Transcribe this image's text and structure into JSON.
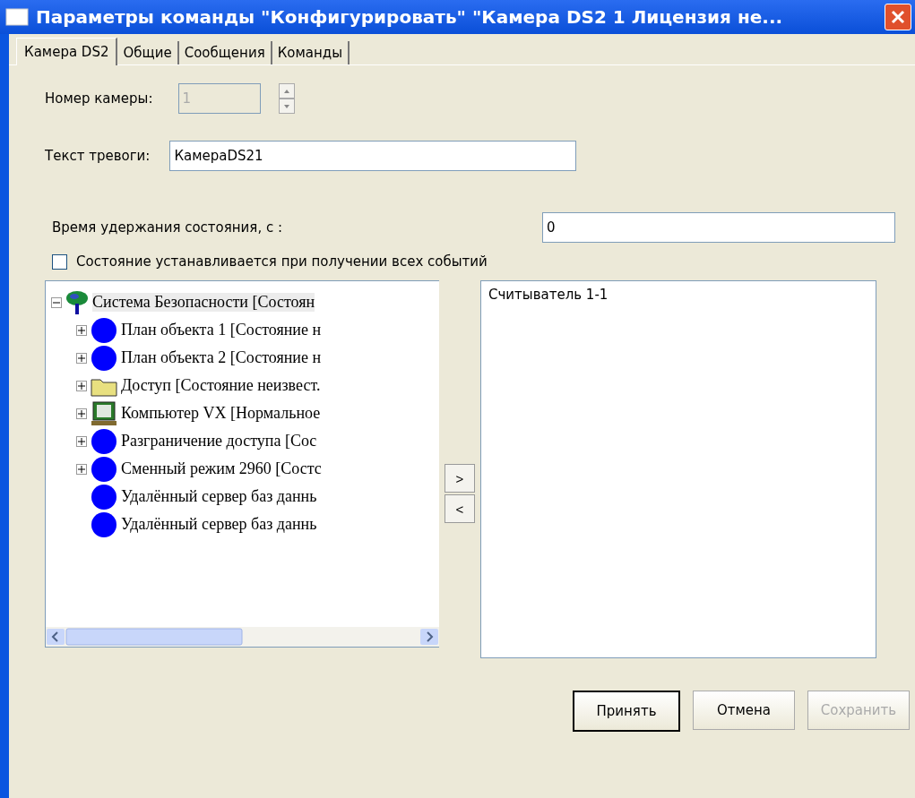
{
  "window": {
    "title": "Параметры команды \"Конфигурировать\" \"Камера DS2 1 Лицензия не..."
  },
  "tabs": [
    {
      "label": "Камера DS2",
      "selected": true
    },
    {
      "label": "Общие",
      "selected": false
    },
    {
      "label": "Сообщения",
      "selected": false
    },
    {
      "label": "Команды",
      "selected": false
    }
  ],
  "camera_number": {
    "label": "Номер камеры:",
    "value": "1",
    "disabled": true
  },
  "alarm_text": {
    "label": "Текст тревоги:",
    "value": "КамераDS21"
  },
  "hold_time": {
    "label": "Время удержания состояния, с :",
    "value": "0"
  },
  "all_events_checkbox": {
    "label": "Состояние устанавливается при получении всех событий",
    "checked": false
  },
  "tree": {
    "label": "Система Безопасности [Состоян",
    "kind": "root",
    "expandable": true,
    "expanded": true,
    "selected": true,
    "children": [
      {
        "label": "План объекта 1 [Состояние н",
        "kind": "dot",
        "expandable": true,
        "expanded": false,
        "selected": false
      },
      {
        "label": "План объекта 2 [Состояние н",
        "kind": "dot",
        "expandable": true,
        "expanded": false,
        "selected": false
      },
      {
        "label": "Доступ [Состояние неизвест.",
        "kind": "folder",
        "expandable": true,
        "expanded": false,
        "selected": false
      },
      {
        "label": "Компьютер VX [Нормальное",
        "kind": "computer",
        "expandable": true,
        "expanded": false,
        "selected": false
      },
      {
        "label": "Разграничение доступа [Сос",
        "kind": "dot",
        "expandable": true,
        "expanded": false,
        "selected": false
      },
      {
        "label": "Сменный режим 2960 [Состс",
        "kind": "dot",
        "expandable": true,
        "expanded": false,
        "selected": false
      },
      {
        "label": "Удалённый сервер баз даннь",
        "kind": "dot",
        "expandable": false,
        "expanded": false,
        "selected": false
      },
      {
        "label": "Удалённый сервер баз даннь",
        "kind": "dot",
        "expandable": false,
        "expanded": false,
        "selected": false
      }
    ]
  },
  "move_buttons": [
    ">",
    "<"
  ],
  "selected_list": [
    {
      "label": "Считыватель 1-1"
    }
  ],
  "buttons": [
    {
      "label": "Принять",
      "default": true,
      "disabled": false
    },
    {
      "label": "Отмена",
      "default": false,
      "disabled": false
    },
    {
      "label": "Сохранить",
      "default": false,
      "disabled": true
    }
  ]
}
